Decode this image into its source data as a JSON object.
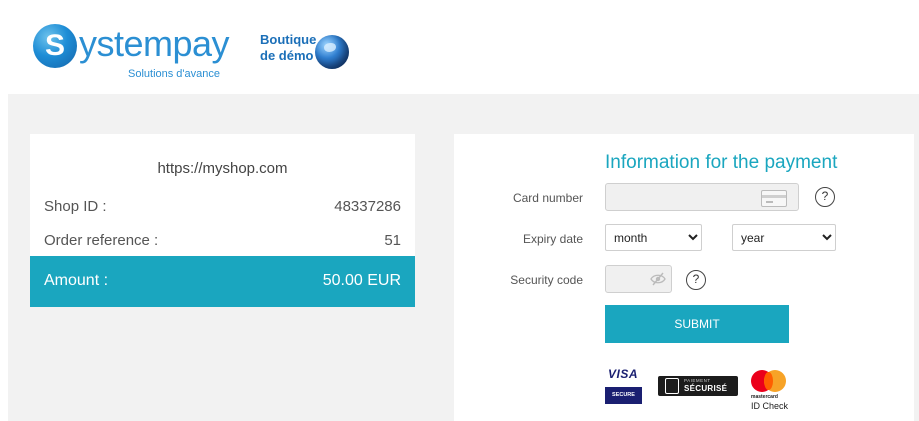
{
  "header": {
    "logo": {
      "letter": "S",
      "word": "ystempay",
      "tagline": "Solutions d'avance"
    },
    "demo_shop": {
      "line1": "Boutique",
      "line2": "de démo"
    }
  },
  "order": {
    "shop_url": "https://myshop.com",
    "shop_id_label": "Shop ID :",
    "shop_id_value": "48337286",
    "order_ref_label": "Order reference :",
    "order_ref_value": "51",
    "amount_label": "Amount :",
    "amount_value": "50.00 EUR"
  },
  "payment": {
    "title": "Information for the payment",
    "card_number_label": "Card number",
    "card_number_value": "",
    "expiry_label": "Expiry date",
    "month_selected": "month",
    "year_selected": "year",
    "security_label": "Security code",
    "security_value": "",
    "help_symbol": "?",
    "submit_label": "SUBMIT"
  },
  "badges": {
    "visa_word": "VISA",
    "visa_secure": "SECURE",
    "secure_top": "PAIEMENT",
    "secure_main": "SÉCURISÉ",
    "mastercard_word": "mastercard",
    "mastercard_id": "ID Check"
  },
  "colors": {
    "accent": "#1aa6bf",
    "background": "#f2f2f2",
    "logo_blue": "#2b8fd3"
  },
  "icons": [
    "systempay-logo-icon",
    "globe-icon",
    "card-icon",
    "help-icon",
    "eye-slash-icon",
    "lock-icon",
    "visa-logo-icon",
    "mastercard-logo-icon"
  ]
}
